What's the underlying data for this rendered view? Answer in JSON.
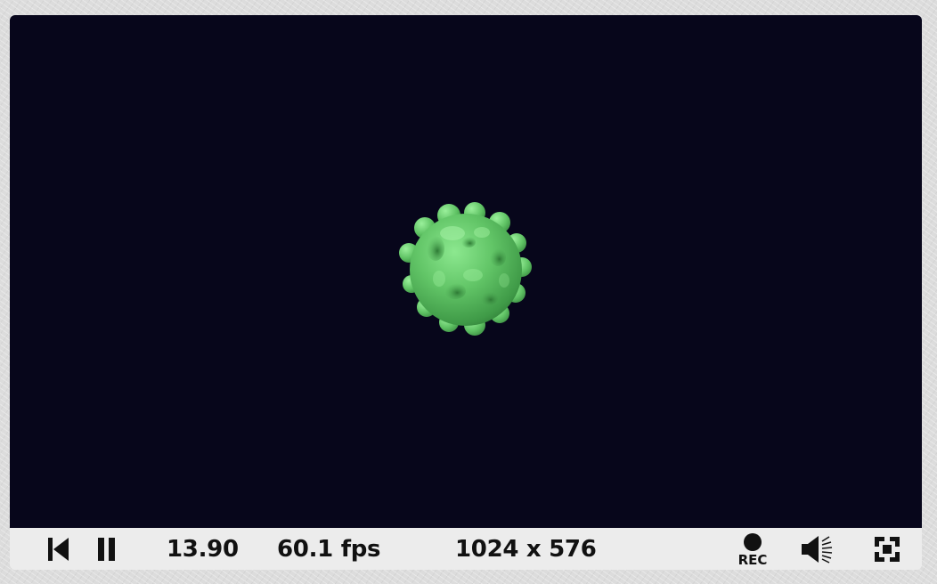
{
  "player": {
    "viewport_background": "#07061b",
    "shape_color": "#63c06a",
    "controls": {
      "rewind_icon": "skip-to-start-icon",
      "pause_icon": "pause-icon",
      "time": "13.90",
      "fps": "60.1 fps",
      "resolution": "1024 x 576",
      "record_label": "REC",
      "record_icon": "record-icon",
      "volume_icon": "speaker-icon",
      "fullscreen_icon": "fullscreen-icon"
    }
  }
}
